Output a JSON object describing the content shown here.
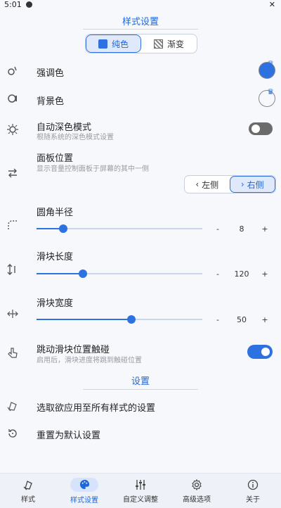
{
  "status": {
    "time": "5:01"
  },
  "style_section": {
    "title": "样式设置"
  },
  "fill_mode": {
    "options": [
      {
        "label": "纯色",
        "active": true
      },
      {
        "label": "渐变",
        "active": false
      }
    ]
  },
  "accent_color": {
    "title": "强调色"
  },
  "background_color": {
    "title": "背景色"
  },
  "auto_dark": {
    "title": "自动深色模式",
    "subtitle": "根随系统的深色模式设置",
    "enabled": false
  },
  "panel_position": {
    "title": "面板位置",
    "subtitle": "显示音量控制面板于屏幕的其中一侧",
    "left": "左侧",
    "right": "右侧",
    "selected": "右侧"
  },
  "corner_radius": {
    "title": "圆角半径",
    "value": "8",
    "fraction": 0.16,
    "minus": "-",
    "plus": "+"
  },
  "slider_length": {
    "title": "滑块长度",
    "value": "120",
    "fraction": 0.28,
    "minus": "-",
    "plus": "+"
  },
  "slider_width": {
    "title": "滑块宽度",
    "value": "50",
    "fraction": 0.57,
    "minus": "-",
    "plus": "+"
  },
  "jump_touch": {
    "title": "跳动滑块位置触碰",
    "subtitle": "启用后，滑块进度将跳到触碰位置",
    "enabled": true
  },
  "settings_section": {
    "title": "设置"
  },
  "actions": {
    "apply_all": "选取欲应用至所有样式的设置",
    "reset": "重置为默认设置"
  },
  "nav": {
    "items": [
      {
        "label": "样式",
        "icon": "layers-icon"
      },
      {
        "label": "样式设置",
        "icon": "palette-icon",
        "active": true
      },
      {
        "label": "自定义调整",
        "icon": "sliders-icon"
      },
      {
        "label": "高级选项",
        "icon": "gear-icon"
      },
      {
        "label": "关于",
        "icon": "info-icon"
      }
    ]
  },
  "colors": {
    "accent": "#2d72e0",
    "background": "#f7f8fc"
  }
}
